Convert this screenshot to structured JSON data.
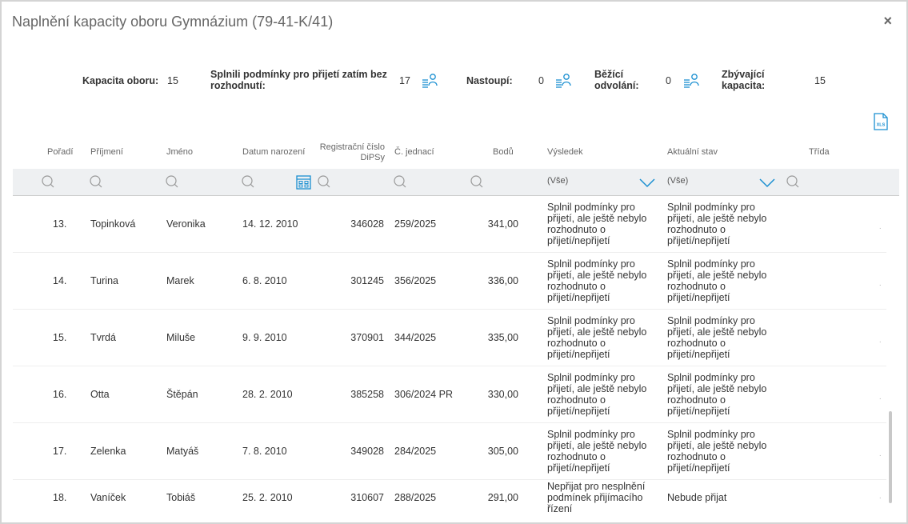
{
  "dialog": {
    "title": "Naplnění kapacity oboru Gymnázium (79-41-K/41)",
    "close": "×"
  },
  "summary": {
    "capacity_label": "Kapacita oboru:",
    "capacity_value": "15",
    "fulfilled_label_1": "Splnili podmínky pro přijetí zatím bez",
    "fulfilled_label_2": "rozhodnutí:",
    "fulfilled_value": "17",
    "start_label": "Nastoupí:",
    "start_value": "0",
    "appeals_label_1": "Běžící",
    "appeals_label_2": "odvolání:",
    "appeals_value": "0",
    "remaining_label_1": "Zbývající",
    "remaining_label_2": "kapacita:",
    "remaining_value": "15"
  },
  "columns": {
    "order": "Pořadí",
    "surname": "Příjmení",
    "name": "Jméno",
    "birth": "Datum narození",
    "reg_1": "Registrační číslo",
    "reg_2": "DiPSy",
    "ref": "Č. jednací",
    "points": "Bodů",
    "result": "Výsledek",
    "state": "Aktuální stav",
    "class": "Třída"
  },
  "filters": {
    "result_value": "(Vše)",
    "state_value": "(Vše)"
  },
  "rows": [
    {
      "order": "13.",
      "surname": "Topinková",
      "name": "Veronika",
      "birth": "14. 12. 2010",
      "reg": "346028",
      "ref": "259/2025",
      "points": "341,00",
      "result": "Splnil podmínky pro přijetí, ale ještě nebylo rozhodnuto o přijetí/nepřijetí",
      "state": "Splnil podmínky pro přijetí, ale ještě nebylo rozhodnuto o přijetí/nepřijetí",
      "class": "·"
    },
    {
      "order": "14.",
      "surname": "Turina",
      "name": "Marek",
      "birth": "6. 8. 2010",
      "reg": "301245",
      "ref": "356/2025",
      "points": "336,00",
      "result": "Splnil podmínky pro přijetí, ale ještě nebylo rozhodnuto o přijetí/nepřijetí",
      "state": "Splnil podmínky pro přijetí, ale ještě nebylo rozhodnuto o přijetí/nepřijetí",
      "class": "·"
    },
    {
      "order": "15.",
      "surname": "Tvrdá",
      "name": "Miluše",
      "birth": "9. 9. 2010",
      "reg": "370901",
      "ref": "344/2025",
      "points": "335,00",
      "result": "Splnil podmínky pro přijetí, ale ještě nebylo rozhodnuto o přijetí/nepřijetí",
      "state": "Splnil podmínky pro přijetí, ale ještě nebylo rozhodnuto o přijetí/nepřijetí",
      "class": "·"
    },
    {
      "order": "16.",
      "surname": "Otta",
      "name": "Štěpán",
      "birth": "28. 2. 2010",
      "reg": "385258",
      "ref": "306/2024 PR",
      "points": "330,00",
      "result": "Splnil podmínky pro přijetí, ale ještě nebylo rozhodnuto o přijetí/nepřijetí",
      "state": "Splnil podmínky pro přijetí, ale ještě nebylo rozhodnuto o přijetí/nepřijetí",
      "class": "·"
    },
    {
      "order": "17.",
      "surname": "Zelenka",
      "name": "Matyáš",
      "birth": "7. 8. 2010",
      "reg": "349028",
      "ref": "284/2025",
      "points": "305,00",
      "result": "Splnil podmínky pro přijetí, ale ještě nebylo rozhodnuto o přijetí/nepřijetí",
      "state": "Splnil podmínky pro přijetí, ale ještě nebylo rozhodnuto o přijetí/nepřijetí",
      "class": "·"
    },
    {
      "order": "18.",
      "surname": "Vaníček",
      "name": "Tobiáš",
      "birth": "25. 2. 2010",
      "reg": "310607",
      "ref": "288/2025",
      "points": "291,00",
      "result": "Nepřijat pro nesplnění podmínek přijímacího řízení",
      "state": "Nebude přijat",
      "class": "·"
    }
  ],
  "icons": {
    "people": "people-list-icon",
    "search": "search-icon",
    "calendar": "calendar-icon",
    "chevron": "chevron-down-icon",
    "xls": "xls-export-icon"
  },
  "colors": {
    "accent": "#1a8fd1",
    "filter_bg": "#eef0f2"
  }
}
